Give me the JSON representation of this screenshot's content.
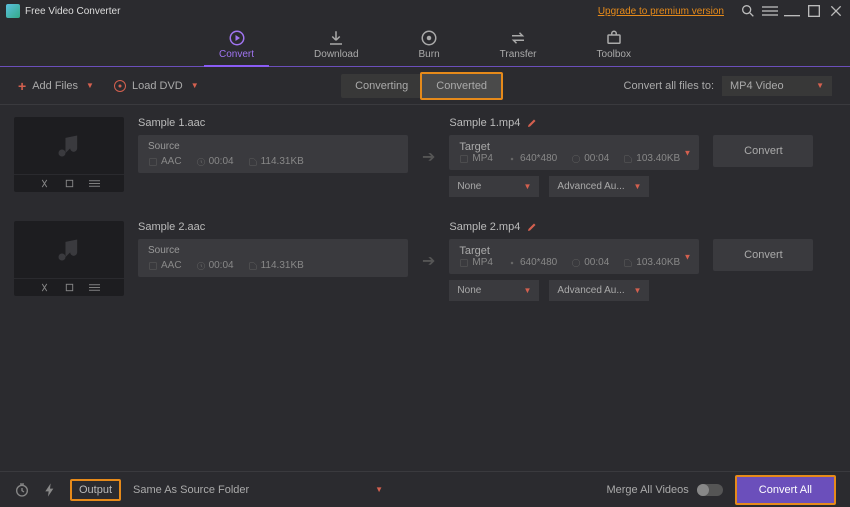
{
  "titlebar": {
    "app_name": "Free Video Converter",
    "premium_link": "Upgrade to premium version"
  },
  "nav": {
    "convert": "Convert",
    "download": "Download",
    "burn": "Burn",
    "transfer": "Transfer",
    "toolbox": "Toolbox"
  },
  "toolbar": {
    "add_files": "Add Files",
    "load_dvd": "Load DVD",
    "tab_converting": "Converting",
    "tab_converted": "Converted",
    "convert_all_to": "Convert all files to:",
    "format": "MP4 Video"
  },
  "files": [
    {
      "src_name": "Sample 1.aac",
      "src_label": "Source",
      "src_fmt": "AAC",
      "src_dur": "00:04",
      "src_size": "114.31KB",
      "tgt_name": "Sample 1.mp4",
      "tgt_label": "Target",
      "tgt_fmt": "MP4",
      "tgt_res": "640*480",
      "tgt_dur": "00:04",
      "tgt_size": "103.40KB",
      "sub": "None",
      "audio": "Advanced Au..."
    },
    {
      "src_name": "Sample 2.aac",
      "src_label": "Source",
      "src_fmt": "AAC",
      "src_dur": "00:04",
      "src_size": "114.31KB",
      "tgt_name": "Sample 2.mp4",
      "tgt_label": "Target",
      "tgt_fmt": "MP4",
      "tgt_res": "640*480",
      "tgt_dur": "00:04",
      "tgt_size": "103.40KB",
      "sub": "None",
      "audio": "Advanced Au..."
    }
  ],
  "row": {
    "convert_btn": "Convert"
  },
  "bottom": {
    "output_label": "Output",
    "output_path": "Same As Source Folder",
    "merge": "Merge All Videos",
    "convert_all": "Convert All"
  }
}
